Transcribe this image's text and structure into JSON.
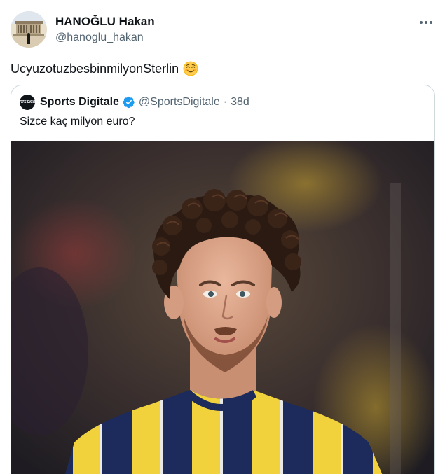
{
  "tweet": {
    "author": {
      "display_name": "HANOĞLU Hakan",
      "handle": "@hanoglu_hakan",
      "avatar_icon": "monument-avatar-icon"
    },
    "text": "UcyuzotuzbesbinmilyonSterlin",
    "emoji": "smiling-face-emoji",
    "more_icon": "more-options-icon"
  },
  "quote": {
    "author": {
      "display_name": "Sports Digitale",
      "handle": "@SportsDigitale",
      "separator": "·",
      "time": "38d",
      "avatar_label": "SPORTS DIGITALE",
      "verified": true
    },
    "text": "Sizce kaç milyon euro?",
    "media": {
      "description_icon": "football-player-photo"
    }
  },
  "colors": {
    "text_primary": "#0f1419",
    "text_secondary": "#536471",
    "border": "#cfd9de",
    "verified_blue": "#1d9bf0",
    "kit_navy": "#1d2a5c",
    "kit_yellow": "#f2d23c"
  }
}
